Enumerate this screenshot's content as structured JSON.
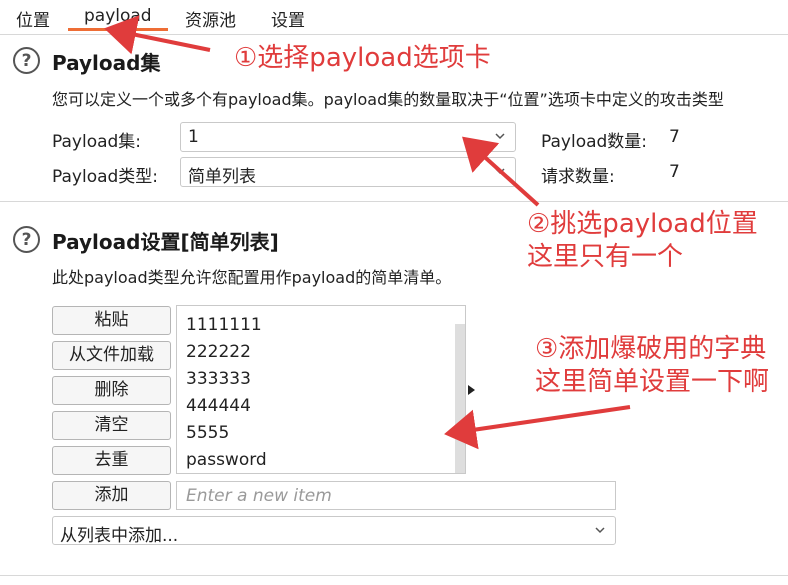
{
  "tabs": [
    {
      "label": "位置"
    },
    {
      "label": "payload"
    },
    {
      "label": "资源池"
    },
    {
      "label": "设置"
    }
  ],
  "payload_sets": {
    "title": "Payload集",
    "description": "您可以定义一个或多个有payload集。payload集的数量取决于“位置”选项卡中定义的攻击类型",
    "set_label": "Payload集:",
    "set_value": "1",
    "type_label": "Payload类型:",
    "type_value": "简单列表",
    "count_label": "Payload数量:",
    "count_value": "7",
    "request_label": "请求数量:",
    "request_value": "7"
  },
  "payload_settings": {
    "title": "Payload设置[简单列表]",
    "description": "此处payload类型允许您配置用作payload的简单清单。",
    "buttons": {
      "paste": "粘贴",
      "load": "从文件加载",
      "remove": "删除",
      "clear": "清空",
      "dedupe": "去重",
      "add": "添加"
    },
    "items": [
      "1111111",
      "222222",
      "333333",
      "444444",
      "5555",
      "password"
    ],
    "new_item_placeholder": "Enter a new item",
    "add_from_list": "从列表中添加..."
  },
  "annotations": {
    "step1": "①选择payload选项卡",
    "step2_line1": "②挑选payload位置",
    "step2_line2": "这里只有一个",
    "step3_line1": "③添加爆破用的字典",
    "step3_line2": "这里简单设置一下啊"
  },
  "colors": {
    "accent": "#ee6d35",
    "annotation": "#e03c3c"
  }
}
